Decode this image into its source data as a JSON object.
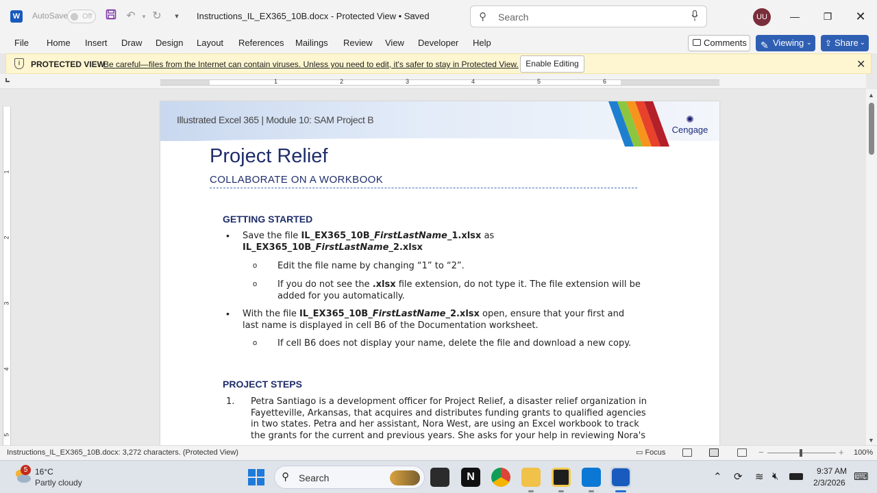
{
  "titlebar": {
    "app_logo": "W",
    "autosave_label": "AutoSave",
    "autosave_state": "Off",
    "doc_title": "Instructions_IL_EX365_10B.docx  -  Protected View • Saved",
    "search_placeholder": "Search",
    "user_initials": "UU"
  },
  "ribbon": {
    "tabs": [
      "File",
      "Home",
      "Insert",
      "Draw",
      "Design",
      "Layout",
      "References",
      "Mailings",
      "Review",
      "View",
      "Developer",
      "Help"
    ],
    "comments_label": "Comments",
    "viewing_label": "Viewing",
    "share_label": "Share"
  },
  "protected_bar": {
    "title": "PROTECTED VIEW",
    "message": "Be careful—files from the Internet can contain viruses. Unless you need to edit, it's safer to stay in Protected View.",
    "enable_label": "Enable Editing"
  },
  "ruler": {
    "numbers": [
      "1",
      "2",
      "3",
      "4",
      "5",
      "6"
    ]
  },
  "vruler": {
    "numbers": [
      "1",
      "2",
      "3",
      "4",
      "5"
    ]
  },
  "document": {
    "header_text": "Illustrated Excel 365 | Module 10: SAM Project B",
    "logo_text": "Cengage",
    "title": "Project Relief",
    "subtitle": "COLLABORATE ON A WORKBOOK",
    "section1": "GETTING STARTED",
    "b1_pre": "Save the file ",
    "b1_file1a": "IL_EX365_10B_",
    "b1_file1b": "FirstLastName",
    "b1_file1c": "_1.xlsx",
    "b1_mid": " as",
    "b1_file2a": "IL_EX365_10B_",
    "b1_file2b": "FirstLastName",
    "b1_file2c": "_2.xlsx",
    "s1": "Edit the file name by changing “1” to “2”.",
    "s2_pre": "If you do not see the ",
    "s2_bold": ".xlsx",
    "s2_post": " file extension, do not type it. The file extension will be",
    "s2_line2": "added for you automatically.",
    "b2_pre": "With the file ",
    "b2_file_a": "IL_EX365_10B_",
    "b2_file_b": "FirstLastName",
    "b2_file_c": "_2.xlsx",
    "b2_post": " open, ensure that your first and",
    "b2_line2": "last name is displayed in cell B6 of the Documentation worksheet.",
    "s3": "If cell B6 does not display your name, delete the file and download a new copy.",
    "section2": "PROJECT STEPS",
    "step1_num": "1.",
    "step1_lines": [
      "Petra Santiago is a development officer for Project Relief, a disaster relief organization in",
      "Fayetteville, Arkansas, that acquires and distributes funding grants to qualified agencies",
      "in two states. Petra and her assistant, Nora West, are using an Excel workbook to track",
      "the grants for the current and previous years. She asks for your help in reviewing Nora's"
    ]
  },
  "statusbar": {
    "status": "Instructions_IL_EX365_10B.docx: 3,272 characters.  (Protected View)",
    "focus": "Focus",
    "zoom": "100%"
  },
  "taskbar": {
    "weather_badge": "5",
    "temp": "16°C",
    "weather": "Partly cloudy",
    "search": "Search",
    "time": "9:37 AM",
    "date": "2/3/2026"
  },
  "colors": {
    "accent": "#2f5fb3",
    "heading": "#1f2d6a",
    "protected_bg": "#fdf6d0",
    "stripes": [
      "#1e7fd0",
      "#8cc63f",
      "#f7941d",
      "#e8412c",
      "#b3202a"
    ]
  }
}
